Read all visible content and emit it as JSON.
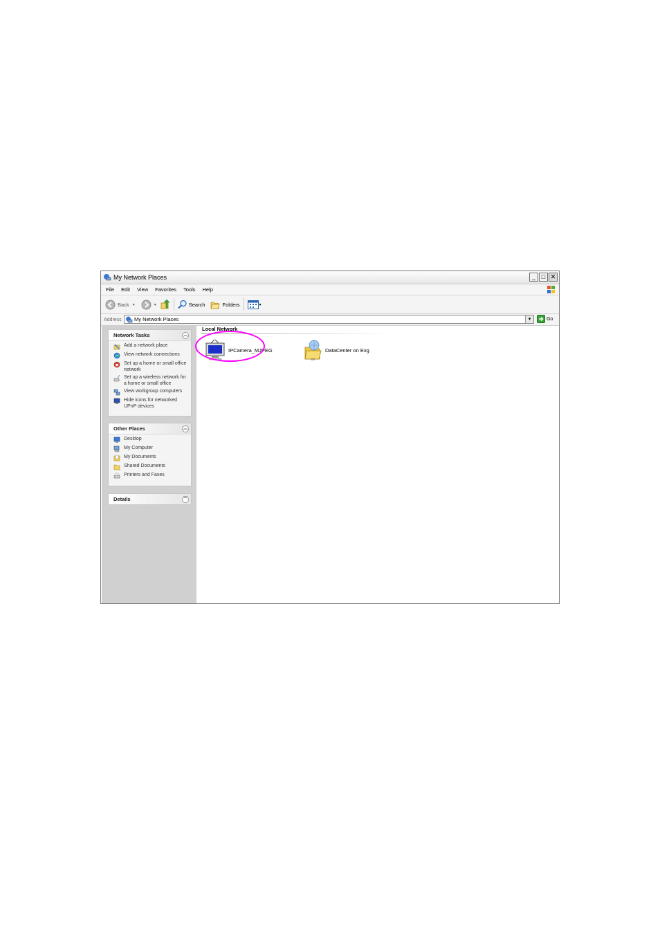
{
  "window": {
    "title": "My Network Places"
  },
  "menubar": {
    "items": [
      "File",
      "Edit",
      "View",
      "Favorites",
      "Tools",
      "Help"
    ]
  },
  "toolbar": {
    "back_label": "Back",
    "search_label": "Search",
    "folders_label": "Folders"
  },
  "address": {
    "label": "Address",
    "value": "My Network Places",
    "go_label": "Go"
  },
  "network_tasks": {
    "title": "Network Tasks",
    "items": [
      {
        "label": "Add a network place",
        "icon": "add-network-place-icon"
      },
      {
        "label": "View network connections",
        "icon": "network-connections-icon"
      },
      {
        "label": "Set up a home or small office network",
        "icon": "home-network-icon"
      },
      {
        "label": "Set up a wireless network for a home or small office",
        "icon": "wireless-network-icon"
      },
      {
        "label": "View workgroup computers",
        "icon": "workgroup-computers-icon"
      },
      {
        "label": "Hide icons for networked UPnP devices",
        "icon": "upnp-devices-icon"
      }
    ]
  },
  "other_places": {
    "title": "Other Places",
    "items": [
      {
        "label": "Desktop",
        "icon": "desktop-icon"
      },
      {
        "label": "My Computer",
        "icon": "my-computer-icon"
      },
      {
        "label": "My Documents",
        "icon": "my-documents-icon"
      },
      {
        "label": "Shared Documents",
        "icon": "shared-documents-icon"
      },
      {
        "label": "Printers and Faxes",
        "icon": "printers-faxes-icon"
      }
    ]
  },
  "details": {
    "title": "Details"
  },
  "content": {
    "group_header": "Local Network",
    "items": [
      {
        "label": "IPCamera_MJPEG",
        "icon": "upnp-camera-icon",
        "highlighted": true
      },
      {
        "label": "DataCenter on Exg",
        "icon": "network-share-icon",
        "highlighted": false
      }
    ],
    "highlight_color": "#ff00ff"
  }
}
